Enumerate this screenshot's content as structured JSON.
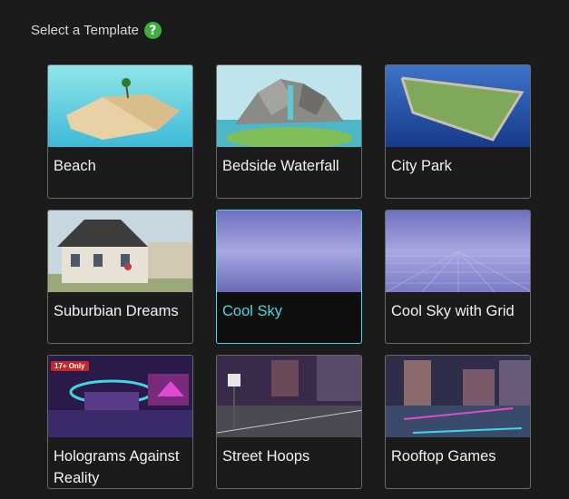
{
  "header": {
    "title": "Select a Template",
    "help_icon": "?"
  },
  "templates": [
    {
      "label": "Beach"
    },
    {
      "label": "Bedside Waterfall"
    },
    {
      "label": "City Park"
    },
    {
      "label": "Suburbian Dreams"
    },
    {
      "label": "Cool Sky",
      "selected": true
    },
    {
      "label": "Cool Sky with Grid"
    },
    {
      "label": "Holograms Against Reality",
      "badge": "17+ Only"
    },
    {
      "label": "Street Hoops"
    },
    {
      "label": "Rooftop Games"
    }
  ],
  "colors": {
    "background": "#1b1b1b",
    "selected_accent": "#4fd6e0",
    "help_green": "#3fae3f"
  }
}
